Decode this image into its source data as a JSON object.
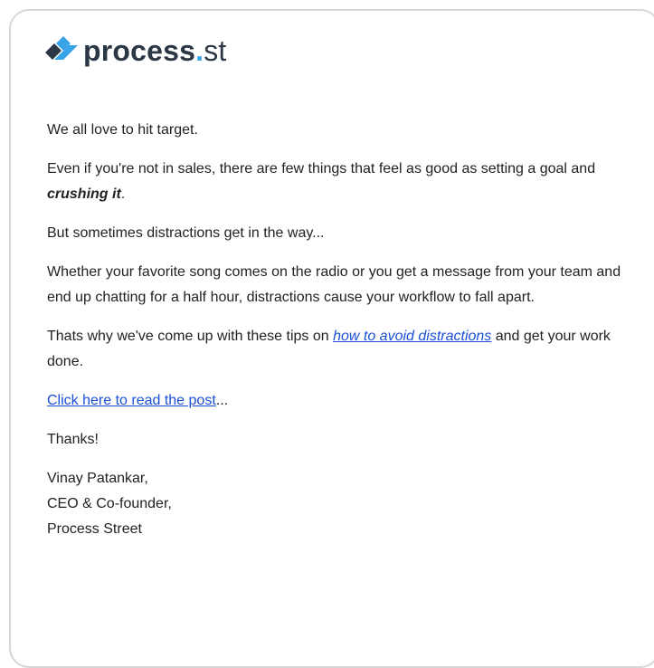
{
  "brand": {
    "name_bold": "process",
    "dot": ".",
    "tld": "st",
    "accent_color": "#38a3e6",
    "text_color": "#2b3744",
    "logo_icon": "process-st-diamond-logo"
  },
  "email": {
    "p1": "We all love to hit target.",
    "p2_before": "Even if you're not in sales, there are few things that feel as good as setting a goal and ",
    "p2_emph": "crushing it",
    "p2_after": ".",
    "p3": "But sometimes distractions get in the way...",
    "p4": "Whether your favorite song comes on the radio or you get a message from your team and end up chatting for a half hour, distractions cause your workflow to fall apart.",
    "p5_before": "Thats why we've come up with these tips on ",
    "p5_link": "how to avoid distractions",
    "p5_after": " and get your work done.",
    "cta_link": "Click here to read the post",
    "cta_after": "...",
    "thanks": "Thanks!",
    "sig_name": "Vinay Patankar,",
    "sig_title": "CEO & Co-founder,",
    "sig_company": "Process Street",
    "link_color": "#1a4fd6"
  }
}
